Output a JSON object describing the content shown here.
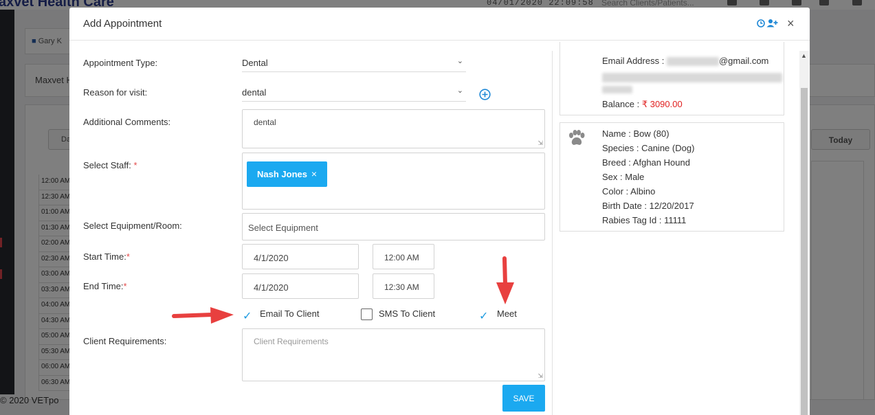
{
  "background": {
    "brand": "axvet Health Care",
    "datetime": "04/01/2020 22:09:58",
    "search_placeholder": "Search Clients/Patients...",
    "user_tab": "Gary K",
    "clinic": "Maxvet H",
    "day_button": "Da",
    "today_button": "Today",
    "time_slots": [
      "12:00 AM",
      "12:30 AM",
      "01:00 AM",
      "01:30 AM",
      "02:00 AM",
      "02:30 AM",
      "03:00 AM",
      "03:30 AM",
      "04:00 AM",
      "04:30 AM",
      "05:00 AM",
      "05:30 AM",
      "06:00 AM",
      "06:30 AM"
    ],
    "footer": "© 2020 VETpo"
  },
  "modal": {
    "title": "Add Appointment",
    "close_glyph": "×",
    "fields": {
      "appointment_type": {
        "label": "Appointment Type:",
        "value": "Dental"
      },
      "reason": {
        "label": "Reason for visit:",
        "value": "dental"
      },
      "comments": {
        "label": "Additional Comments:",
        "value": "dental"
      },
      "staff": {
        "label": "Select Staff:",
        "chip": "Nash Jones",
        "chip_remove": "×"
      },
      "equipment": {
        "label": "Select Equipment/Room:",
        "placeholder": "Select Equipment"
      },
      "start": {
        "label": "Start Time:",
        "date": "4/1/2020",
        "time": "12:00 AM"
      },
      "end": {
        "label": "End Time:",
        "date": "4/1/2020",
        "time": "12:30 AM"
      },
      "requirements": {
        "label": "Client Requirements:",
        "placeholder": "Client Requirements"
      }
    },
    "required_mark": "*",
    "options": {
      "email": {
        "label": "Email To Client",
        "checked": true
      },
      "sms": {
        "label": "SMS To Client",
        "checked": false
      },
      "meet": {
        "label": "Meet",
        "checked": true
      }
    },
    "save_label": "SAVE"
  },
  "client_card": {
    "email_label": "Email Address :",
    "email_domain": "@gmail.com",
    "balance_label": "Balance :",
    "balance_value": "₹ 3090.00",
    "balance_color": "#e02020"
  },
  "patient_card": {
    "name": "Name : Bow (80)",
    "species": "Species : Canine (Dog)",
    "breed": "Breed : Afghan Hound",
    "sex": "Sex : Male",
    "color": "Color : Albino",
    "birth_date": "Birth Date : 12/20/2017",
    "rabies": "Rabies Tag Id : 11111"
  },
  "colors": {
    "accent": "#1ba9f0",
    "check": "#1e9be0",
    "annotation_arrow": "#e8403f"
  }
}
